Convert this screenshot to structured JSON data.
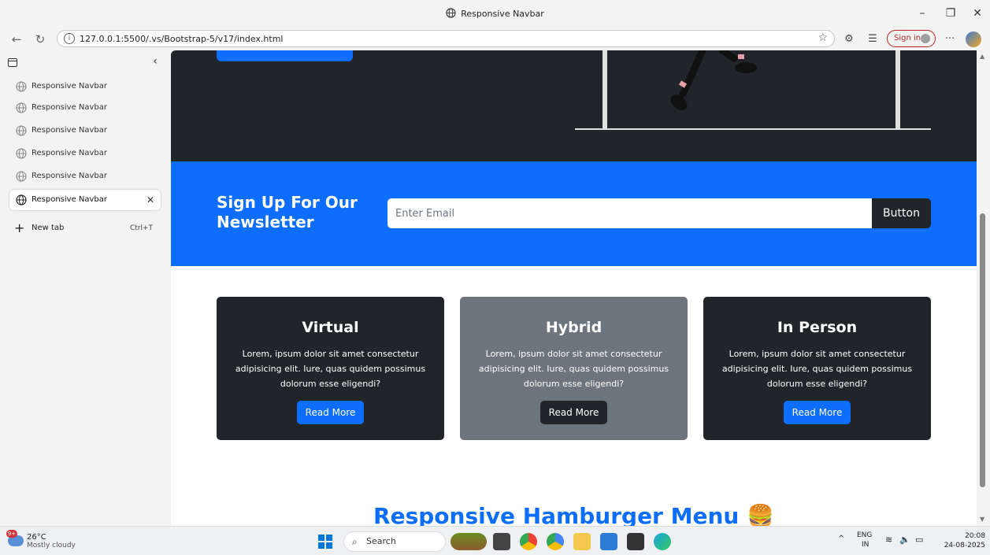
{
  "window": {
    "title": "Responsive Navbar"
  },
  "addressbar": {
    "url": "127.0.0.1:5500/.vs/Bootstrap-5/v17/index.html",
    "signin_label": "Sign in"
  },
  "sidebar": {
    "tabs": [
      {
        "label": "Responsive Navbar"
      },
      {
        "label": "Responsive Navbar"
      },
      {
        "label": "Responsive Navbar"
      },
      {
        "label": "Responsive Navbar"
      },
      {
        "label": "Responsive Navbar"
      },
      {
        "label": "Responsive Navbar",
        "active": true
      }
    ],
    "new_tab_label": "New tab",
    "new_tab_shortcut": "Ctrl+T"
  },
  "page": {
    "newsletter": {
      "title": "Sign Up For Our Newsletter",
      "input_placeholder": "Enter Email",
      "button_label": "Button"
    },
    "cards": [
      {
        "title": "Virtual",
        "text": "Lorem, ipsum dolor sit amet consectetur adipisicing elit. Iure, quas quidem possimus dolorum esse eligendi?",
        "button": "Read More",
        "bg": "#212529",
        "button_bg": "#0d6efd"
      },
      {
        "title": "Hybrid",
        "text": "Lorem, ipsum dolor sit amet consectetur adipisicing elit. Iure, quas quidem possimus dolorum esse eligendi?",
        "button": "Read More",
        "bg": "#6c757d",
        "button_bg": "#212529"
      },
      {
        "title": "In Person",
        "text": "Lorem, ipsum dolor sit amet consectetur adipisicing elit. Iure, quas quidem possimus dolorum esse eligendi?",
        "button": "Read More",
        "bg": "#212529",
        "button_bg": "#0d6efd"
      }
    ],
    "section_heading": "Responsive Hamburger Menu 🍔"
  },
  "taskbar": {
    "weather_temp": "26°C",
    "weather_condition": "Mostly cloudy",
    "weather_badge": "9+",
    "search_label": "Search",
    "lang_top": "ENG",
    "lang_bottom": "IN",
    "time": "20:08",
    "date": "24-08-2025"
  },
  "colors": {
    "primary": "#0d6efd",
    "dark": "#212529",
    "secondary": "#6c757d"
  }
}
